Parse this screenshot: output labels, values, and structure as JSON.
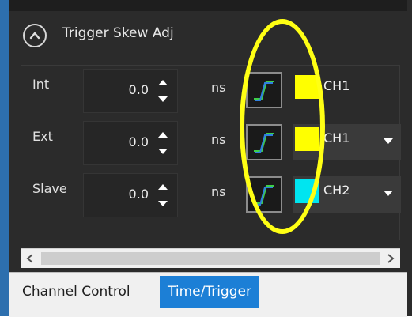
{
  "section": {
    "title": "Trigger Skew Adj"
  },
  "rows": [
    {
      "label": "Int",
      "value": "0.0",
      "unit": "ns",
      "channel": "CH1",
      "swatch_color": "#ffff00",
      "has_dropdown": false
    },
    {
      "label": "Ext",
      "value": "0.0",
      "unit": "ns",
      "channel": "CH1",
      "swatch_color": "#ffff00",
      "has_dropdown": true
    },
    {
      "label": "Slave",
      "value": "0.0",
      "unit": "ns",
      "channel": "CH2",
      "swatch_color": "#00e5f0",
      "has_dropdown": true
    }
  ],
  "tabs": [
    {
      "label": "Channel Control",
      "active": false
    },
    {
      "label": "Time/Trigger",
      "active": true
    }
  ],
  "colors": {
    "annotation": "#ffff14",
    "active_tab": "#1c7fd6",
    "edge_icon_green": "#3ecf4a",
    "edge_icon_blue": "#2f7fe0"
  },
  "icons": {
    "collapse": "chevron-up-icon",
    "spin_up": "triangle-up-icon",
    "spin_down": "triangle-down-icon",
    "edge": "rising-edge-icon",
    "dropdown": "chevron-down-icon",
    "scroll_left": "chevron-left-icon",
    "scroll_right": "chevron-right-icon"
  }
}
